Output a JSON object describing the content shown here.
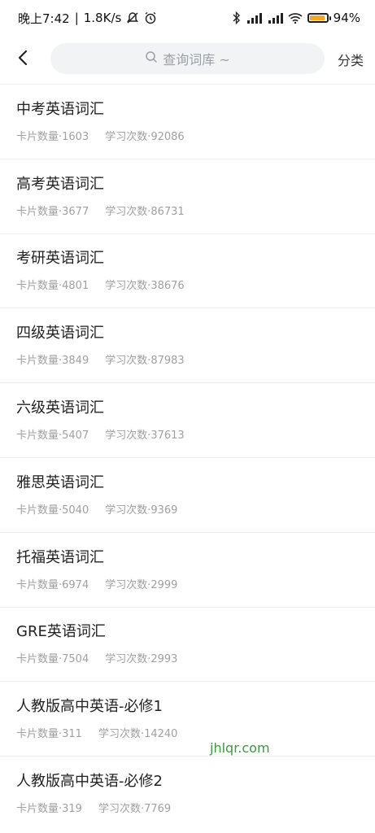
{
  "status_bar": {
    "time": "晚上7:42",
    "speed": "1.8K/s",
    "battery": "94%",
    "battery_level": 0.94
  },
  "header": {
    "search_placeholder": "查询词库 ~",
    "category_label": "分类"
  },
  "items": [
    {
      "title": "中考英语词汇",
      "cards": "卡片数量·1603",
      "studies": "学习次数·92086"
    },
    {
      "title": "高考英语词汇",
      "cards": "卡片数量·3677",
      "studies": "学习次数·86731"
    },
    {
      "title": "考研英语词汇",
      "cards": "卡片数量·4801",
      "studies": "学习次数·38676"
    },
    {
      "title": "四级英语词汇",
      "cards": "卡片数量·3849",
      "studies": "学习次数·87983"
    },
    {
      "title": "六级英语词汇",
      "cards": "卡片数量·5407",
      "studies": "学习次数·37613"
    },
    {
      "title": "雅思英语词汇",
      "cards": "卡片数量·5040",
      "studies": "学习次数·9369"
    },
    {
      "title": "托福英语词汇",
      "cards": "卡片数量·6974",
      "studies": "学习次数·2999"
    },
    {
      "title": "GRE英语词汇",
      "cards": "卡片数量·7504",
      "studies": "学习次数·2993"
    },
    {
      "title": "人教版高中英语-必修1",
      "cards": "卡片数量·311",
      "studies": "学习次数·14240"
    },
    {
      "title": "人教版高中英语-必修2",
      "cards": "卡片数量·319",
      "studies": "学习次数·7769"
    }
  ],
  "watermark": "jhlqr.com"
}
